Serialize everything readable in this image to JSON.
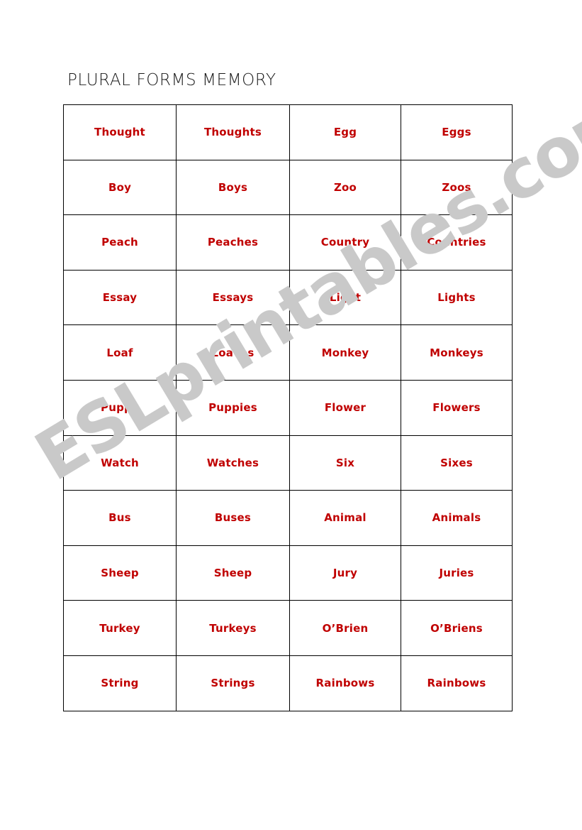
{
  "document": {
    "title": "PLURAL FORMS MEMORY",
    "watermark": "ESLprintables.com",
    "colors": {
      "word_text": "#C00000",
      "title_text": "#1A1A1A",
      "table_border": "#000000",
      "watermark": "#C9C9C9",
      "page_background": "#FFFFFF"
    }
  },
  "table": {
    "columns": 4,
    "rows": 11,
    "cells": [
      [
        "Thought",
        "Thoughts",
        "Egg",
        "Eggs"
      ],
      [
        "Boy",
        "Boys",
        "Zoo",
        "Zoos"
      ],
      [
        "Peach",
        "Peaches",
        "Country",
        "Countries"
      ],
      [
        "Essay",
        "Essays",
        "Light",
        "Lights"
      ],
      [
        "Loaf",
        "Loaves",
        "Monkey",
        "Monkeys"
      ],
      [
        "Puppy",
        "Puppies",
        "Flower",
        "Flowers"
      ],
      [
        "Watch",
        "Watches",
        "Six",
        "Sixes"
      ],
      [
        "Bus",
        "Buses",
        "Animal",
        "Animals"
      ],
      [
        "Sheep",
        "Sheep",
        "Jury",
        "Juries"
      ],
      [
        "Turkey",
        "Turkeys",
        "O’Brien",
        "O’Briens"
      ],
      [
        "String",
        "Strings",
        "Rainbows",
        "Rainbows"
      ]
    ]
  }
}
